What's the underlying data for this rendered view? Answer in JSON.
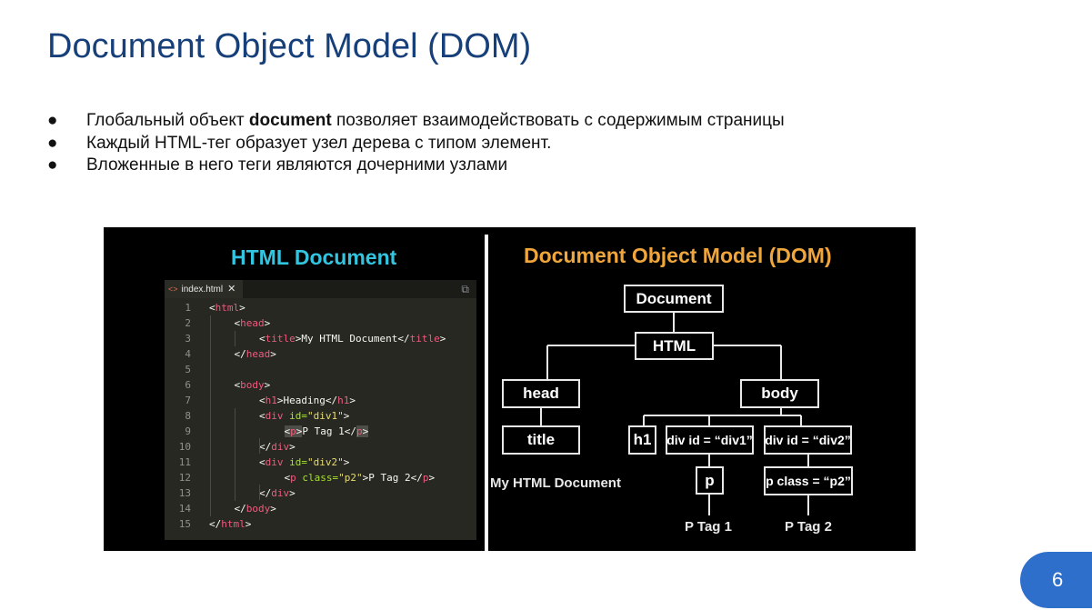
{
  "slide": {
    "title": "Document Object Model (DOM)",
    "bullet_marker": "●",
    "bullets": [
      {
        "before": "Глобальный объект ",
        "bold": "document",
        "after": " позволяет взаимодействовать с содержимым страницы"
      },
      {
        "text": "Каждый HTML-тег образует узел дерева с типом элемент."
      },
      {
        "text": "Вложенные в него теги являются дочерними узлами"
      }
    ],
    "page_number": "6"
  },
  "figure": {
    "left_title": "HTML Document",
    "right_title": "Document Object Model (DOM)",
    "editor": {
      "tab_icon": "<>",
      "tab_name": "index.html",
      "tab_close": "✕",
      "split_icon": "⧉",
      "lines": [
        {
          "n": "1",
          "indent": 0,
          "parts": [
            [
              "p",
              "<"
            ],
            [
              "t",
              "html"
            ],
            [
              "p",
              ">"
            ]
          ]
        },
        {
          "n": "2",
          "indent": 1,
          "parts": [
            [
              "p",
              "<"
            ],
            [
              "t",
              "head"
            ],
            [
              "p",
              ">"
            ]
          ]
        },
        {
          "n": "3",
          "indent": 2,
          "parts": [
            [
              "p",
              "<"
            ],
            [
              "t",
              "title"
            ],
            [
              "p",
              ">My HTML Document</"
            ],
            [
              "t",
              "title"
            ],
            [
              "p",
              ">"
            ]
          ]
        },
        {
          "n": "4",
          "indent": 1,
          "parts": [
            [
              "p",
              "</"
            ],
            [
              "t",
              "head"
            ],
            [
              "p",
              ">"
            ]
          ]
        },
        {
          "n": "5",
          "indent": 0,
          "parts": []
        },
        {
          "n": "6",
          "indent": 1,
          "parts": [
            [
              "p",
              "<"
            ],
            [
              "t",
              "body"
            ],
            [
              "p",
              ">"
            ]
          ]
        },
        {
          "n": "7",
          "indent": 2,
          "parts": [
            [
              "p",
              "<"
            ],
            [
              "t",
              "h1"
            ],
            [
              "p",
              ">Heading</"
            ],
            [
              "t",
              "h1"
            ],
            [
              "p",
              ">"
            ]
          ]
        },
        {
          "n": "8",
          "indent": 2,
          "parts": [
            [
              "p",
              "<"
            ],
            [
              "t",
              "div"
            ],
            [
              "p",
              " "
            ],
            [
              "a",
              "id="
            ],
            [
              "s",
              "\"div1\""
            ],
            [
              "p",
              ">"
            ]
          ]
        },
        {
          "n": "9",
          "indent": 3,
          "parts": [
            [
              "sel",
              "<"
            ],
            [
              "selt",
              "p"
            ],
            [
              "sel",
              ">"
            ],
            [
              "p",
              "P Tag 1</"
            ],
            [
              "selt",
              "p"
            ],
            [
              "sel",
              ">"
            ]
          ]
        },
        {
          "n": "10",
          "indent": 2,
          "parts": [
            [
              "p",
              "</"
            ],
            [
              "t",
              "div"
            ],
            [
              "p",
              ">"
            ]
          ]
        },
        {
          "n": "11",
          "indent": 2,
          "parts": [
            [
              "p",
              "<"
            ],
            [
              "t",
              "div"
            ],
            [
              "p",
              " "
            ],
            [
              "a",
              "id="
            ],
            [
              "s",
              "\"div2\""
            ],
            [
              "p",
              ">"
            ]
          ]
        },
        {
          "n": "12",
          "indent": 3,
          "parts": [
            [
              "p",
              "<"
            ],
            [
              "t",
              "p"
            ],
            [
              "p",
              " "
            ],
            [
              "a",
              "class="
            ],
            [
              "s",
              "\"p2\""
            ],
            [
              "p",
              ">P Tag 2</"
            ],
            [
              "t",
              "p"
            ],
            [
              "p",
              ">"
            ]
          ]
        },
        {
          "n": "13",
          "indent": 2,
          "parts": [
            [
              "p",
              "</"
            ],
            [
              "t",
              "div"
            ],
            [
              "p",
              ">"
            ]
          ]
        },
        {
          "n": "14",
          "indent": 1,
          "parts": [
            [
              "p",
              "</"
            ],
            [
              "t",
              "body"
            ],
            [
              "p",
              ">"
            ]
          ]
        },
        {
          "n": "15",
          "indent": 0,
          "parts": [
            [
              "p",
              "</"
            ],
            [
              "t",
              "html"
            ],
            [
              "p",
              ">"
            ]
          ]
        }
      ]
    },
    "tree": {
      "document": "Document",
      "html": "HTML",
      "head": "head",
      "body": "body",
      "title": "title",
      "title_text": "My HTML Document",
      "h1": "h1",
      "div1": "div id = “div1”",
      "div2": "div id = “div2”",
      "p": "p",
      "p2": "p class = “p2”",
      "p1_text": "P Tag 1",
      "p2_text": "P Tag 2"
    }
  }
}
